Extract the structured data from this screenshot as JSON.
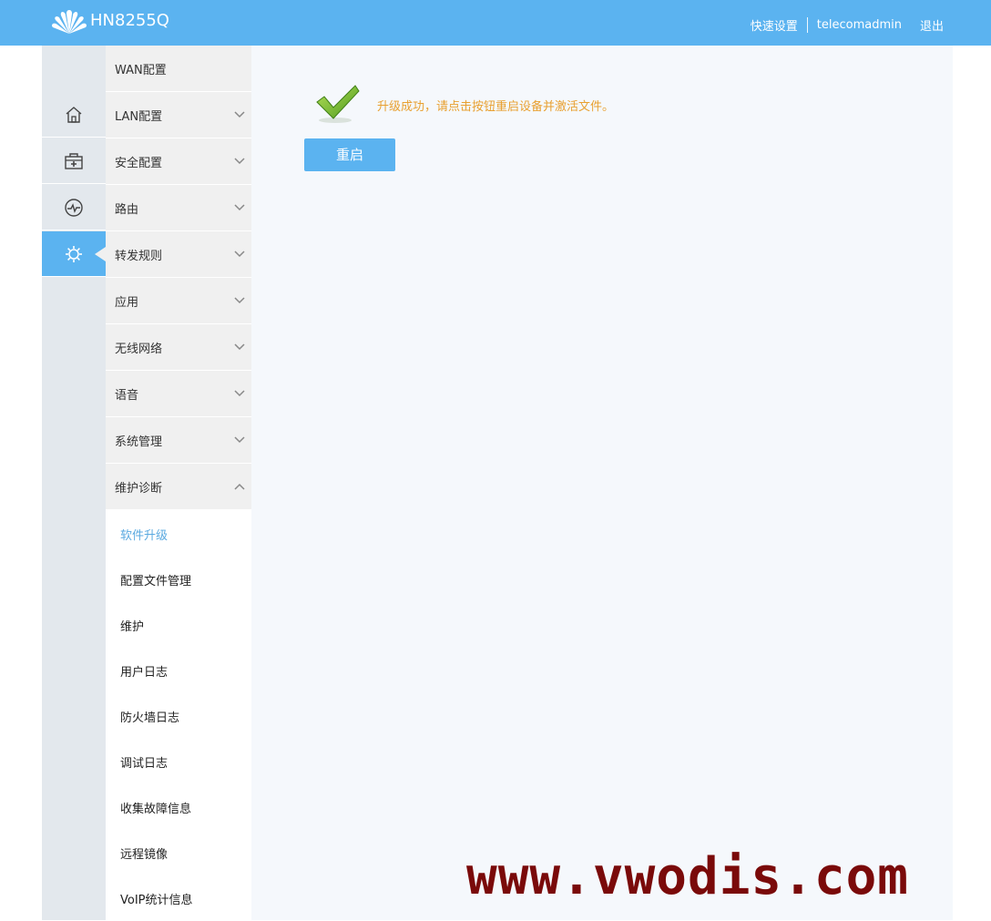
{
  "header": {
    "brand": "HN8255Q",
    "quick_setup": "快速设置",
    "username": "telecomadmin",
    "logout": "退出"
  },
  "icon_nav": [
    {
      "icon": "home-icon"
    },
    {
      "icon": "toolbox-icon"
    },
    {
      "icon": "pulse-icon"
    },
    {
      "icon": "gear-icon",
      "active": true
    }
  ],
  "menu": {
    "items": [
      {
        "label": "WAN配置"
      },
      {
        "label": "LAN配置"
      },
      {
        "label": "安全配置"
      },
      {
        "label": "路由"
      },
      {
        "label": "转发规则"
      },
      {
        "label": "应用"
      },
      {
        "label": "无线网络"
      },
      {
        "label": "语音"
      },
      {
        "label": "系统管理"
      },
      {
        "label": "维护诊断"
      }
    ],
    "sub_items": [
      {
        "label": "软件升级",
        "active": true
      },
      {
        "label": "配置文件管理"
      },
      {
        "label": "维护"
      },
      {
        "label": "用户日志"
      },
      {
        "label": "防火墙日志"
      },
      {
        "label": "调试日志"
      },
      {
        "label": "收集故障信息"
      },
      {
        "label": "远程镜像"
      },
      {
        "label": "VoIP统计信息"
      }
    ]
  },
  "main": {
    "message": "升级成功，请点击按钮重启设备并激活文件。",
    "reboot_label": "重启"
  },
  "watermark": "www.vwodis.com",
  "colors": {
    "accent": "#5bb3f0",
    "message": "#e8a030",
    "active_sub": "#5aa9e0"
  }
}
